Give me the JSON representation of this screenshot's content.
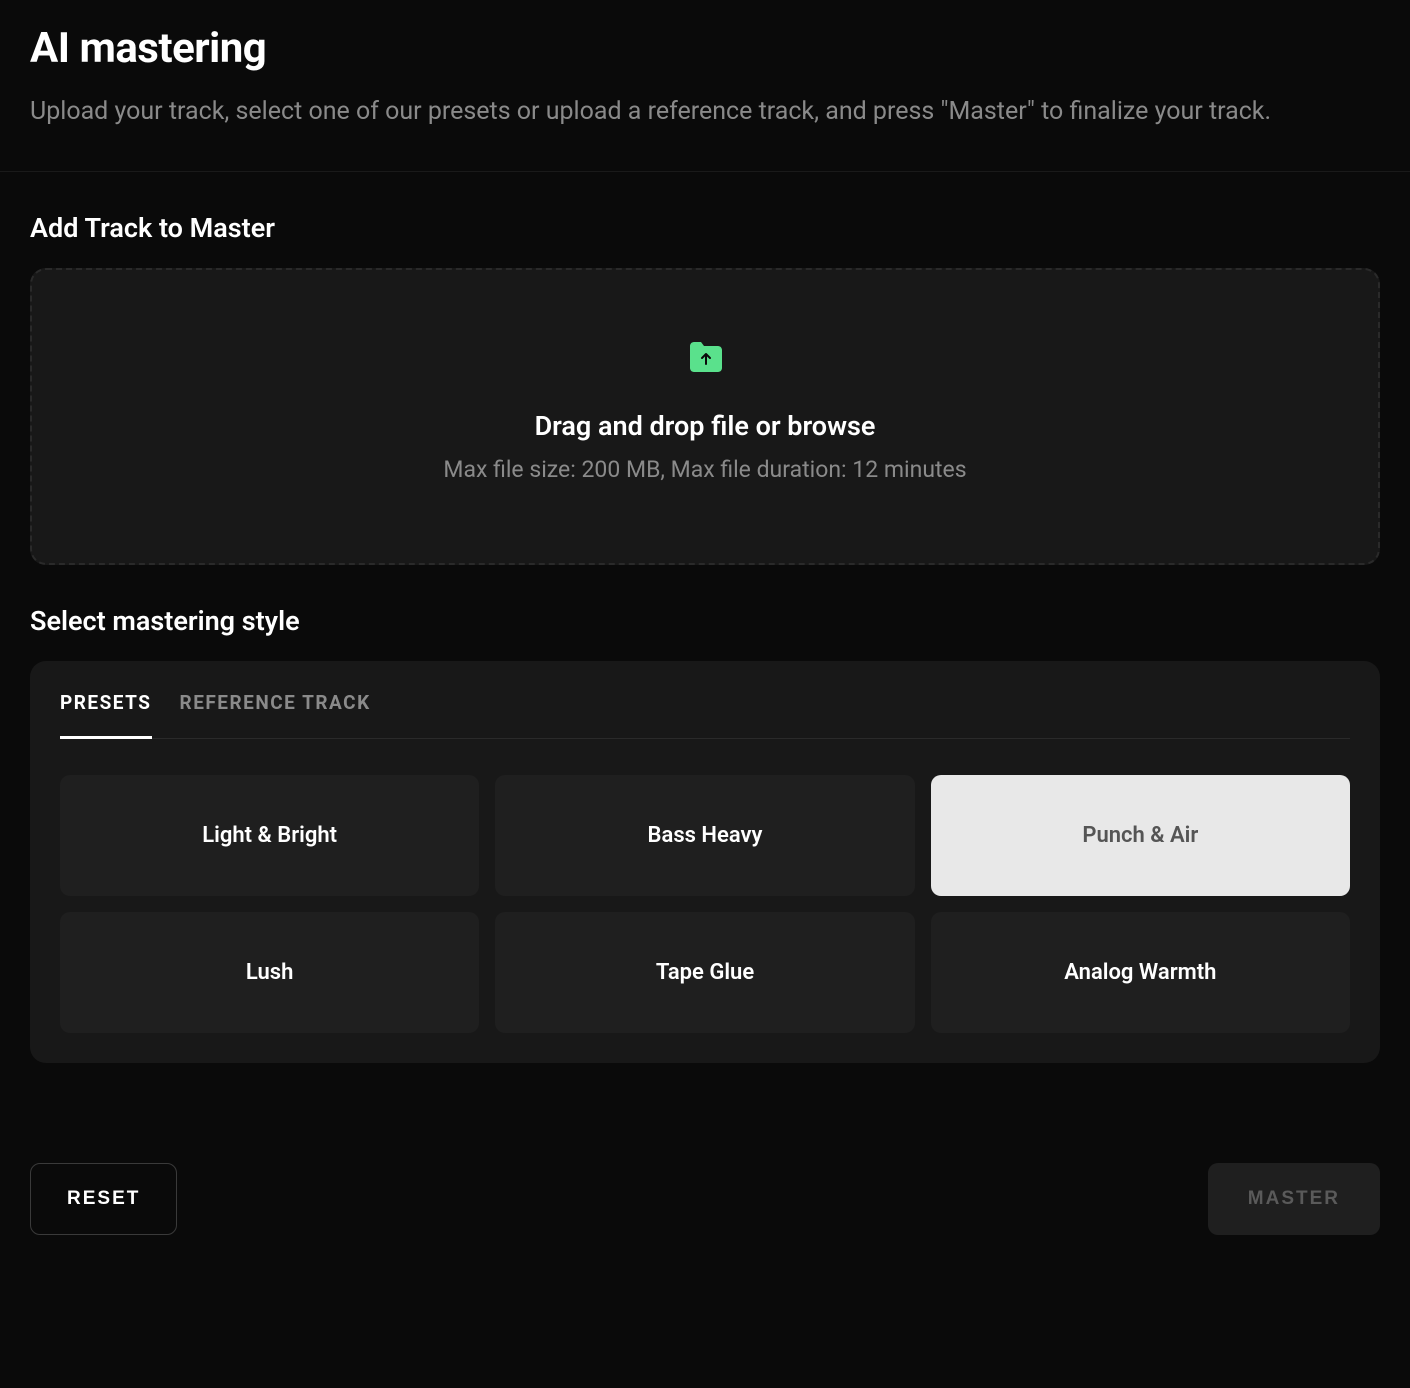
{
  "header": {
    "title": "AI mastering",
    "subtitle": "Upload your track, select one of our presets or upload a reference track, and press \"Master\" to finalize your track."
  },
  "upload": {
    "heading": "Add Track to Master",
    "dropzone_title": "Drag and drop file or browse",
    "dropzone_subtitle": "Max file size: 200 MB, Max file duration: 12 minutes",
    "icon_color": "#5ae18c"
  },
  "style": {
    "heading": "Select mastering style",
    "tabs": [
      {
        "label": "PRESETS",
        "active": true
      },
      {
        "label": "REFERENCE TRACK",
        "active": false
      }
    ],
    "presets": [
      {
        "label": "Light & Bright",
        "selected": false
      },
      {
        "label": "Bass Heavy",
        "selected": false
      },
      {
        "label": "Punch & Air",
        "selected": true
      },
      {
        "label": "Lush",
        "selected": false
      },
      {
        "label": "Tape Glue",
        "selected": false
      },
      {
        "label": "Analog Warmth",
        "selected": false
      }
    ]
  },
  "actions": {
    "reset_label": "RESET",
    "master_label": "MASTER"
  }
}
